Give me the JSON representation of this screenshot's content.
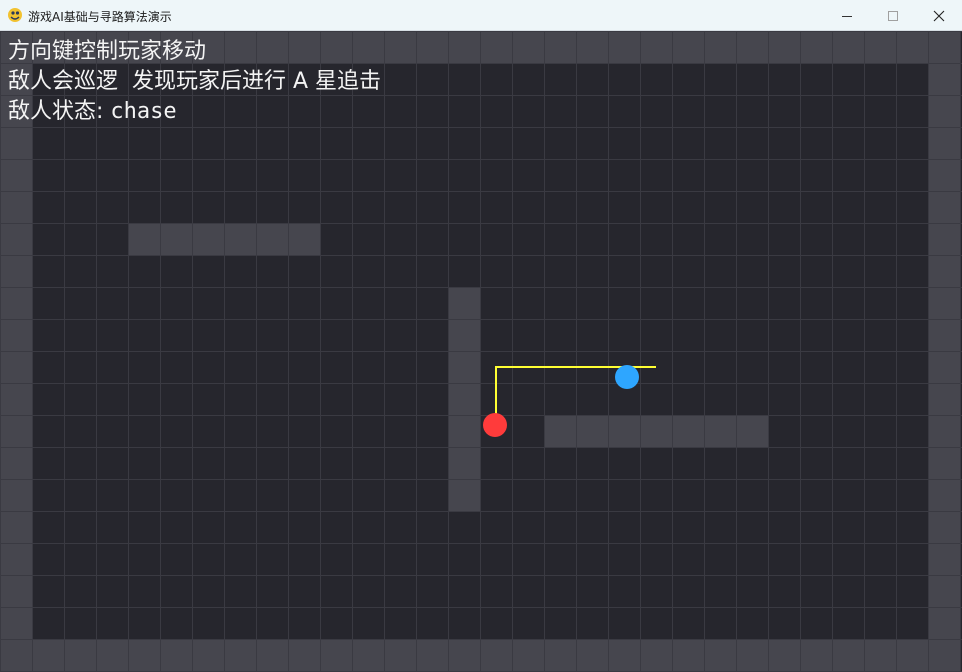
{
  "window": {
    "title": "游戏AI基础与寻路算法演示",
    "icon": "pygame-snake-icon",
    "controls": [
      "minimize-icon",
      "maximize-icon",
      "close-icon"
    ]
  },
  "hud": {
    "line1": "方向键控制玩家移动",
    "line2": "敌人会巡逻  发现玩家后进行 A 星追击",
    "line3_label": "敌人状态: ",
    "line3_state": "chase"
  },
  "grid": {
    "cols": 30,
    "rows": 20,
    "walls": [
      [
        4,
        6
      ],
      [
        5,
        6
      ],
      [
        6,
        6
      ],
      [
        7,
        6
      ],
      [
        8,
        6
      ],
      [
        9,
        6
      ],
      [
        14,
        8
      ],
      [
        14,
        9
      ],
      [
        14,
        10
      ],
      [
        14,
        11
      ],
      [
        14,
        12
      ],
      [
        14,
        13
      ],
      [
        14,
        14
      ],
      [
        17,
        12
      ],
      [
        18,
        12
      ],
      [
        19,
        12
      ],
      [
        20,
        12
      ],
      [
        21,
        12
      ],
      [
        22,
        12
      ],
      [
        23,
        12
      ]
    ],
    "player_cell": [
      15,
      12
    ],
    "enemy_cell": [
      19,
      10
    ],
    "path_cells": [
      [
        15,
        12
      ],
      [
        15,
        11
      ],
      [
        15,
        10
      ],
      [
        16,
        10
      ],
      [
        17,
        10
      ],
      [
        18,
        10
      ],
      [
        19,
        10
      ],
      [
        20,
        10
      ]
    ]
  },
  "colors": {
    "floor": "#26262d",
    "grid_line": "#3a3a42",
    "wall": "#46464e",
    "player": "#ff3b3b",
    "enemy": "#2ea6ff",
    "path": "#ffff33",
    "text": "#f4f4f4"
  }
}
